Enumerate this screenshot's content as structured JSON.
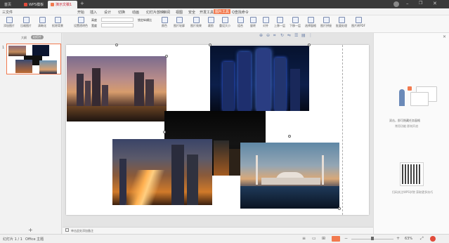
{
  "titlebar": {
    "tabs": [
      {
        "label": "首页",
        "active": false
      },
      {
        "label": "WPS模板",
        "active": false
      },
      {
        "label": "演示文稿1",
        "active": true
      }
    ],
    "add_tab": "+"
  },
  "menubar": {
    "items": [
      "三文件",
      "开始",
      "插入",
      "设计",
      "切换",
      "动画",
      "幻灯片放映",
      "审阅",
      "视图",
      "安全",
      "开发工具",
      "图片工具",
      "Q查找命令"
    ],
    "highlight_index": 11
  },
  "ribbon": {
    "buttons": [
      "添加图片",
      "压缩图片",
      "清晰化",
      "抠除背景",
      "设置透明色",
      "颜色",
      "图片轮廓",
      "图片效果",
      "裁剪",
      "重设大小",
      "组合",
      "旋转",
      "对齐",
      "上移一层",
      "下移一层",
      "选择窗格",
      "图片拼接",
      "批量处理",
      "图片转PDF"
    ],
    "height_label": "高度",
    "width_label": "宽度",
    "lock_ratio_label": "锁定纵横比"
  },
  "leftpanel": {
    "tab_outline": "大纲",
    "tab_slides": "幻灯片",
    "slide_number": "1",
    "add_slide": "+"
  },
  "slide": {
    "notes_placeholder": "单击此处添加备注"
  },
  "rightpanel": {
    "hint_line1": "双击，即可隐藏任务窗格",
    "hint_line2": "常用功能 即刻开启",
    "qr_caption": "扫码关注WPS学院 获取更多技巧"
  },
  "statusbar": {
    "page": "幻灯片 1 / 1",
    "theme": "Office 主题",
    "zoom": "63%"
  },
  "colors": {
    "accent": "#f27a4f",
    "titlebar": "#3a3a3a"
  }
}
